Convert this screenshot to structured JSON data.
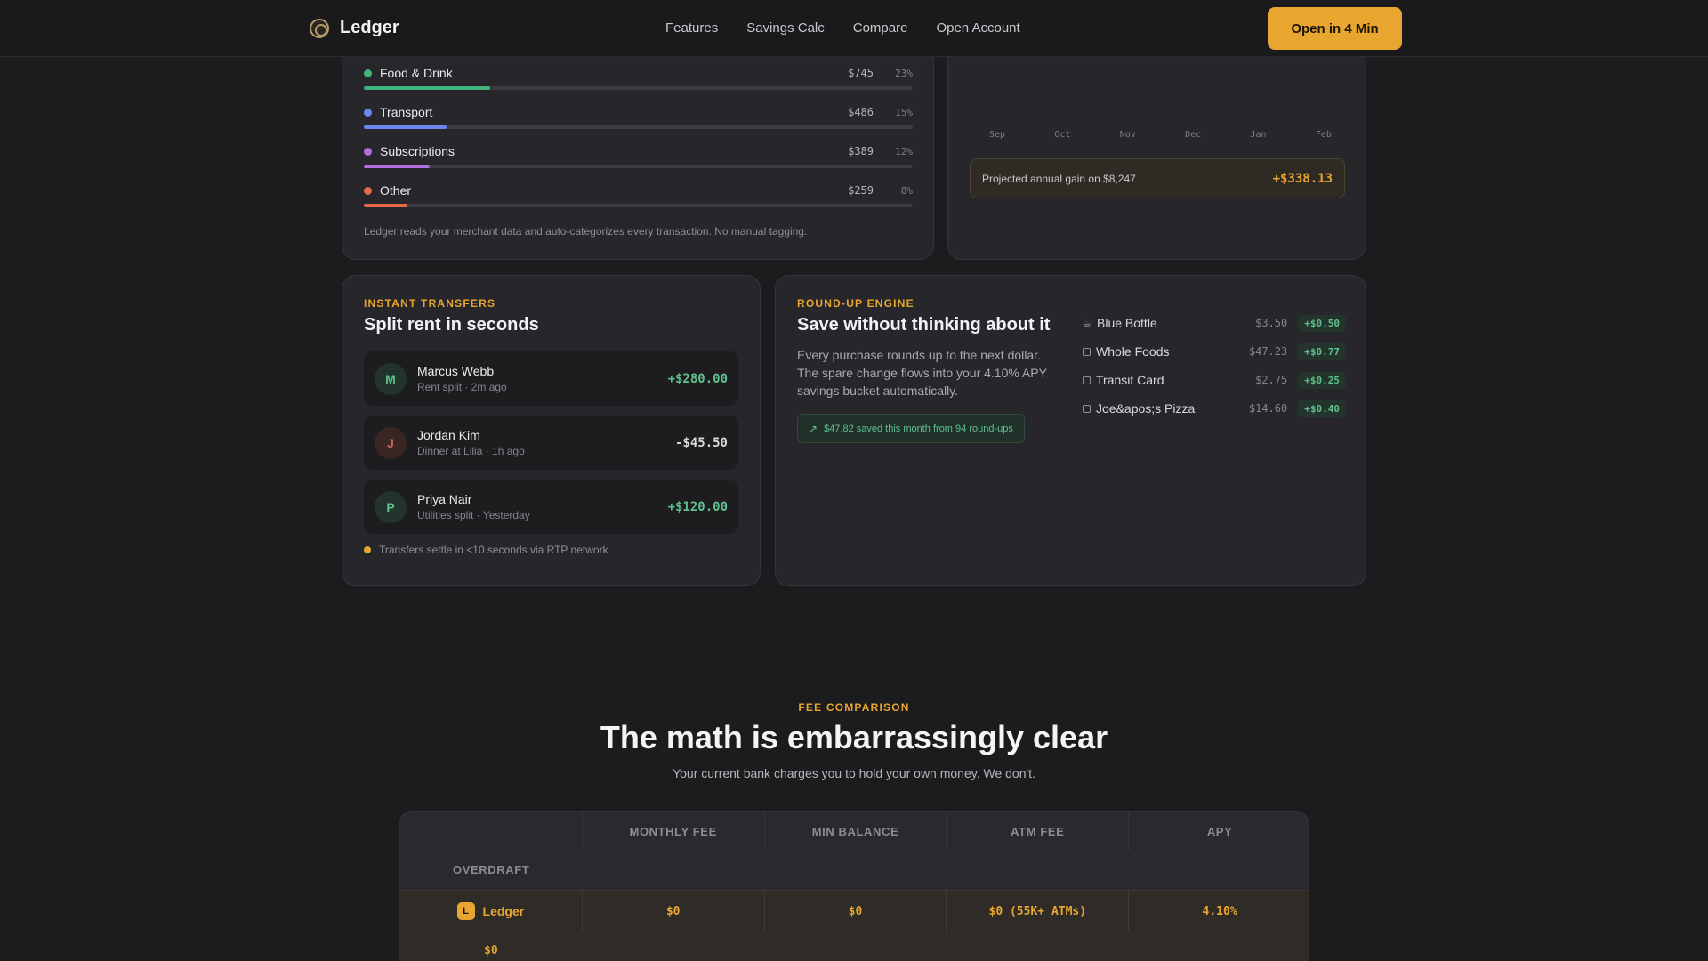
{
  "nav": {
    "brand": "Ledger",
    "links": [
      "Features",
      "Savings Calc",
      "Compare",
      "Open Account"
    ],
    "cta": "Open in 4 Min"
  },
  "spending": {
    "categories": [
      {
        "name": "Food & Drink",
        "amount": "$745",
        "pct": "23%",
        "color": "#3fb57a",
        "share": 0.23
      },
      {
        "name": "Transport",
        "amount": "$486",
        "pct": "15%",
        "color": "#6c86f0",
        "share": 0.15
      },
      {
        "name": "Subscriptions",
        "amount": "$389",
        "pct": "12%",
        "color": "#b46fe0",
        "share": 0.12
      },
      {
        "name": "Other",
        "amount": "$259",
        "pct": "8%",
        "color": "#e8684a",
        "share": 0.08
      }
    ],
    "note": "Ledger reads your merchant data and auto-categorizes every transaction. No manual tagging."
  },
  "savings": {
    "months": [
      "Sep",
      "Oct",
      "Nov",
      "Dec",
      "Jan",
      "Feb"
    ],
    "gain_label": "Projected annual gain on $8,247",
    "gain_value": "+$338.13"
  },
  "transfers": {
    "eyebrow": "INSTANT TRANSFERS",
    "title": "Split rent in seconds",
    "items": [
      {
        "initial": "M",
        "name": "Marcus Webb",
        "sub": "Rent split · 2m ago",
        "amount": "+$280.00"
      },
      {
        "initial": "J",
        "name": "Jordan Kim",
        "sub": "Dinner at Lilia · 1h ago",
        "amount": "-$45.50"
      },
      {
        "initial": "P",
        "name": "Priya Nair",
        "sub": "Utilities split · Yesterday",
        "amount": "+$120.00"
      }
    ],
    "note": "Transfers settle in <10 seconds via RTP network"
  },
  "roundup": {
    "eyebrow": "ROUND-UP ENGINE",
    "title": "Save without thinking about it",
    "body": "Every purchase rounds up to the next dollar. The spare change flows into your 4.10% APY savings bucket automatically.",
    "pill": "$47.82 saved this month from 94 round-ups",
    "items": [
      {
        "name": "Blue Bottle",
        "price": "$3.50",
        "round": "+$0.50",
        "icon": "coffee-icon"
      },
      {
        "name": "Whole Foods",
        "price": "$47.23",
        "round": "+$0.77",
        "icon": "box-icon"
      },
      {
        "name": "Transit Card",
        "price": "$2.75",
        "round": "+$0.25",
        "icon": "box-icon"
      },
      {
        "name": "Joe&apos;s Pizza",
        "price": "$14.60",
        "round": "+$0.40",
        "icon": "box-icon"
      }
    ]
  },
  "fees": {
    "eyebrow": "FEE COMPARISON",
    "title": "The math is embarrassingly clear",
    "subtitle": "Your current bank charges you to hold your own money. We don't.",
    "headers": [
      "MONTHLY FEE",
      "MIN BALANCE",
      "ATM FEE",
      "APY",
      "OVERDRAFT"
    ],
    "ledger": {
      "badge": "L",
      "name": "Ledger",
      "monthly_fee": "$0",
      "min_balance": "$0",
      "atm_fee": "$0 (55K+ ATMs)",
      "apy": "4.10%",
      "overdraft": "$0"
    }
  }
}
